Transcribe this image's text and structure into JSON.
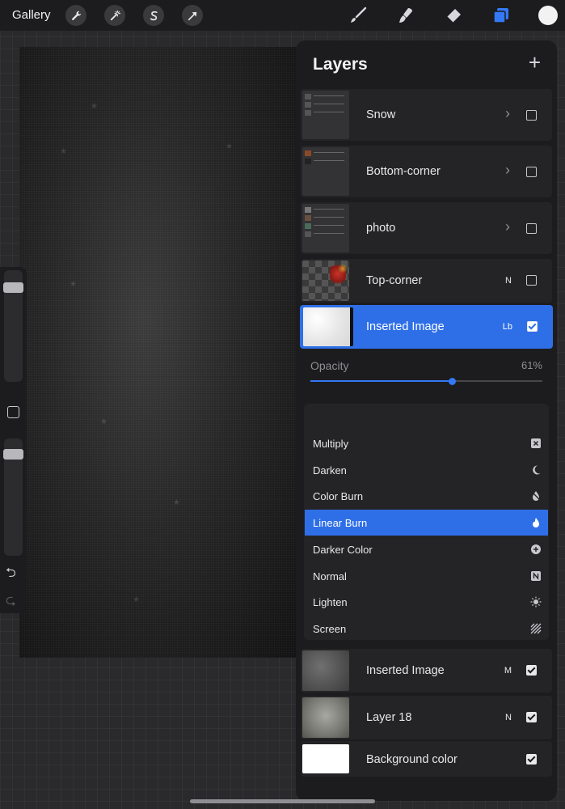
{
  "topbar": {
    "gallery_label": "Gallery",
    "left_tools": [
      "wrench-icon",
      "magic-wand-icon",
      "selection-icon",
      "transform-arrow-icon"
    ],
    "right_tools": [
      "brush-icon",
      "smudge-icon",
      "eraser-icon",
      "layers-icon",
      "color-swatch"
    ],
    "accent": "#3478f6"
  },
  "layers_panel": {
    "title": "Layers",
    "add_symbol": "+",
    "layers": [
      {
        "name": "Snow",
        "type": "group",
        "mode": "",
        "visible": false,
        "selected": false
      },
      {
        "name": "Bottom-corner",
        "type": "group",
        "mode": "",
        "visible": false,
        "selected": false
      },
      {
        "name": "photo",
        "type": "group",
        "mode": "",
        "visible": false,
        "selected": false
      },
      {
        "name": "Top-corner",
        "type": "layer",
        "mode": "N",
        "visible": false,
        "selected": false
      },
      {
        "name": "Inserted Image",
        "type": "layer",
        "mode": "Lb",
        "visible": true,
        "selected": true
      },
      {
        "name": "Inserted Image",
        "type": "layer",
        "mode": "M",
        "visible": true,
        "selected": false
      },
      {
        "name": "Layer 18",
        "type": "layer",
        "mode": "N",
        "visible": true,
        "selected": false
      },
      {
        "name": "Background color",
        "type": "background",
        "mode": "",
        "visible": true,
        "selected": false
      }
    ],
    "opacity": {
      "label": "Opacity",
      "value_text": "61%",
      "value": 0.61
    },
    "blend_modes": [
      {
        "label": "Multiply",
        "icon": "multiply-icon",
        "active": false
      },
      {
        "label": "Darken",
        "icon": "moon-icon",
        "active": false
      },
      {
        "label": "Color Burn",
        "icon": "color-burn-icon",
        "active": false
      },
      {
        "label": "Linear Burn",
        "icon": "flame-icon",
        "active": true
      },
      {
        "label": "Darker Color",
        "icon": "plus-circle-icon",
        "active": false
      },
      {
        "label": "Normal",
        "icon": "normal-n-icon",
        "active": false
      },
      {
        "label": "Lighten",
        "icon": "sun-icon",
        "active": false
      },
      {
        "label": "Screen",
        "icon": "hatch-icon",
        "active": false
      }
    ]
  },
  "sidebar": {
    "brush_size": 0.88,
    "brush_opacity": 0.9,
    "undo_symbol": "⮌",
    "redo_symbol": "⮎"
  }
}
